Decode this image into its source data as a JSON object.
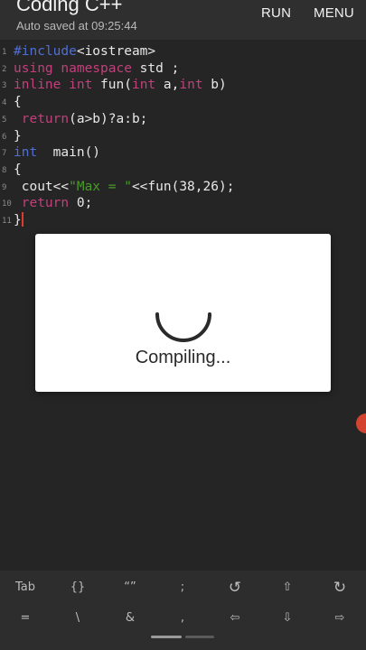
{
  "appbar": {
    "title": "Coding C++",
    "subtitle": "Auto saved at 09:25:44",
    "run_label": "RUN",
    "menu_label": "MENU"
  },
  "editor": {
    "lines": [
      {
        "num": "1",
        "parts": [
          {
            "t": "#include",
            "c": "kw-blue"
          },
          {
            "t": "<iostream>",
            "c": "plain"
          }
        ]
      },
      {
        "num": "2",
        "parts": [
          {
            "t": "using namespace",
            "c": "kw-pink"
          },
          {
            "t": " std ;",
            "c": "plain"
          }
        ]
      },
      {
        "num": "3",
        "parts": [
          {
            "t": "inline int",
            "c": "kw-pink"
          },
          {
            "t": " fun(",
            "c": "plain"
          },
          {
            "t": "int",
            "c": "kw-pink"
          },
          {
            "t": " a,",
            "c": "plain"
          },
          {
            "t": "int",
            "c": "kw-pink"
          },
          {
            "t": " b)",
            "c": "plain"
          }
        ]
      },
      {
        "num": "4",
        "parts": [
          {
            "t": "{",
            "c": "plain"
          }
        ]
      },
      {
        "num": "5",
        "parts": [
          {
            "t": " return",
            "c": "kw-pink"
          },
          {
            "t": "(a>b)?a:b;",
            "c": "plain"
          }
        ]
      },
      {
        "num": "6",
        "parts": [
          {
            "t": "}",
            "c": "plain"
          }
        ]
      },
      {
        "num": "7",
        "parts": [
          {
            "t": "int",
            "c": "kw-blue"
          },
          {
            "t": "  main()",
            "c": "plain"
          }
        ]
      },
      {
        "num": "8",
        "parts": [
          {
            "t": "{",
            "c": "plain"
          }
        ]
      },
      {
        "num": "9",
        "parts": [
          {
            "t": " cout<<",
            "c": "plain"
          },
          {
            "t": "\"Max = \"",
            "c": "str"
          },
          {
            "t": "<<fun(38,26);",
            "c": "plain"
          }
        ]
      },
      {
        "num": "10",
        "parts": [
          {
            "t": " return",
            "c": "kw-pink"
          },
          {
            "t": " 0;",
            "c": "plain"
          }
        ]
      },
      {
        "num": "11",
        "parts": [
          {
            "t": "}",
            "c": "plain"
          }
        ]
      }
    ]
  },
  "dialog": {
    "message": "Compiling..."
  },
  "keys": {
    "row1": [
      "Tab",
      "{}",
      "“”",
      ";",
      "↺",
      "⇧",
      "↻"
    ],
    "row2": [
      "=",
      "\\",
      "&",
      ",",
      "⇦",
      "⇩",
      "⇨"
    ]
  },
  "colors": {
    "accent": "#d3432f",
    "keyword_blue": "#4f6fd6",
    "keyword_pink": "#c2407c",
    "string": "#4a9a2a"
  }
}
